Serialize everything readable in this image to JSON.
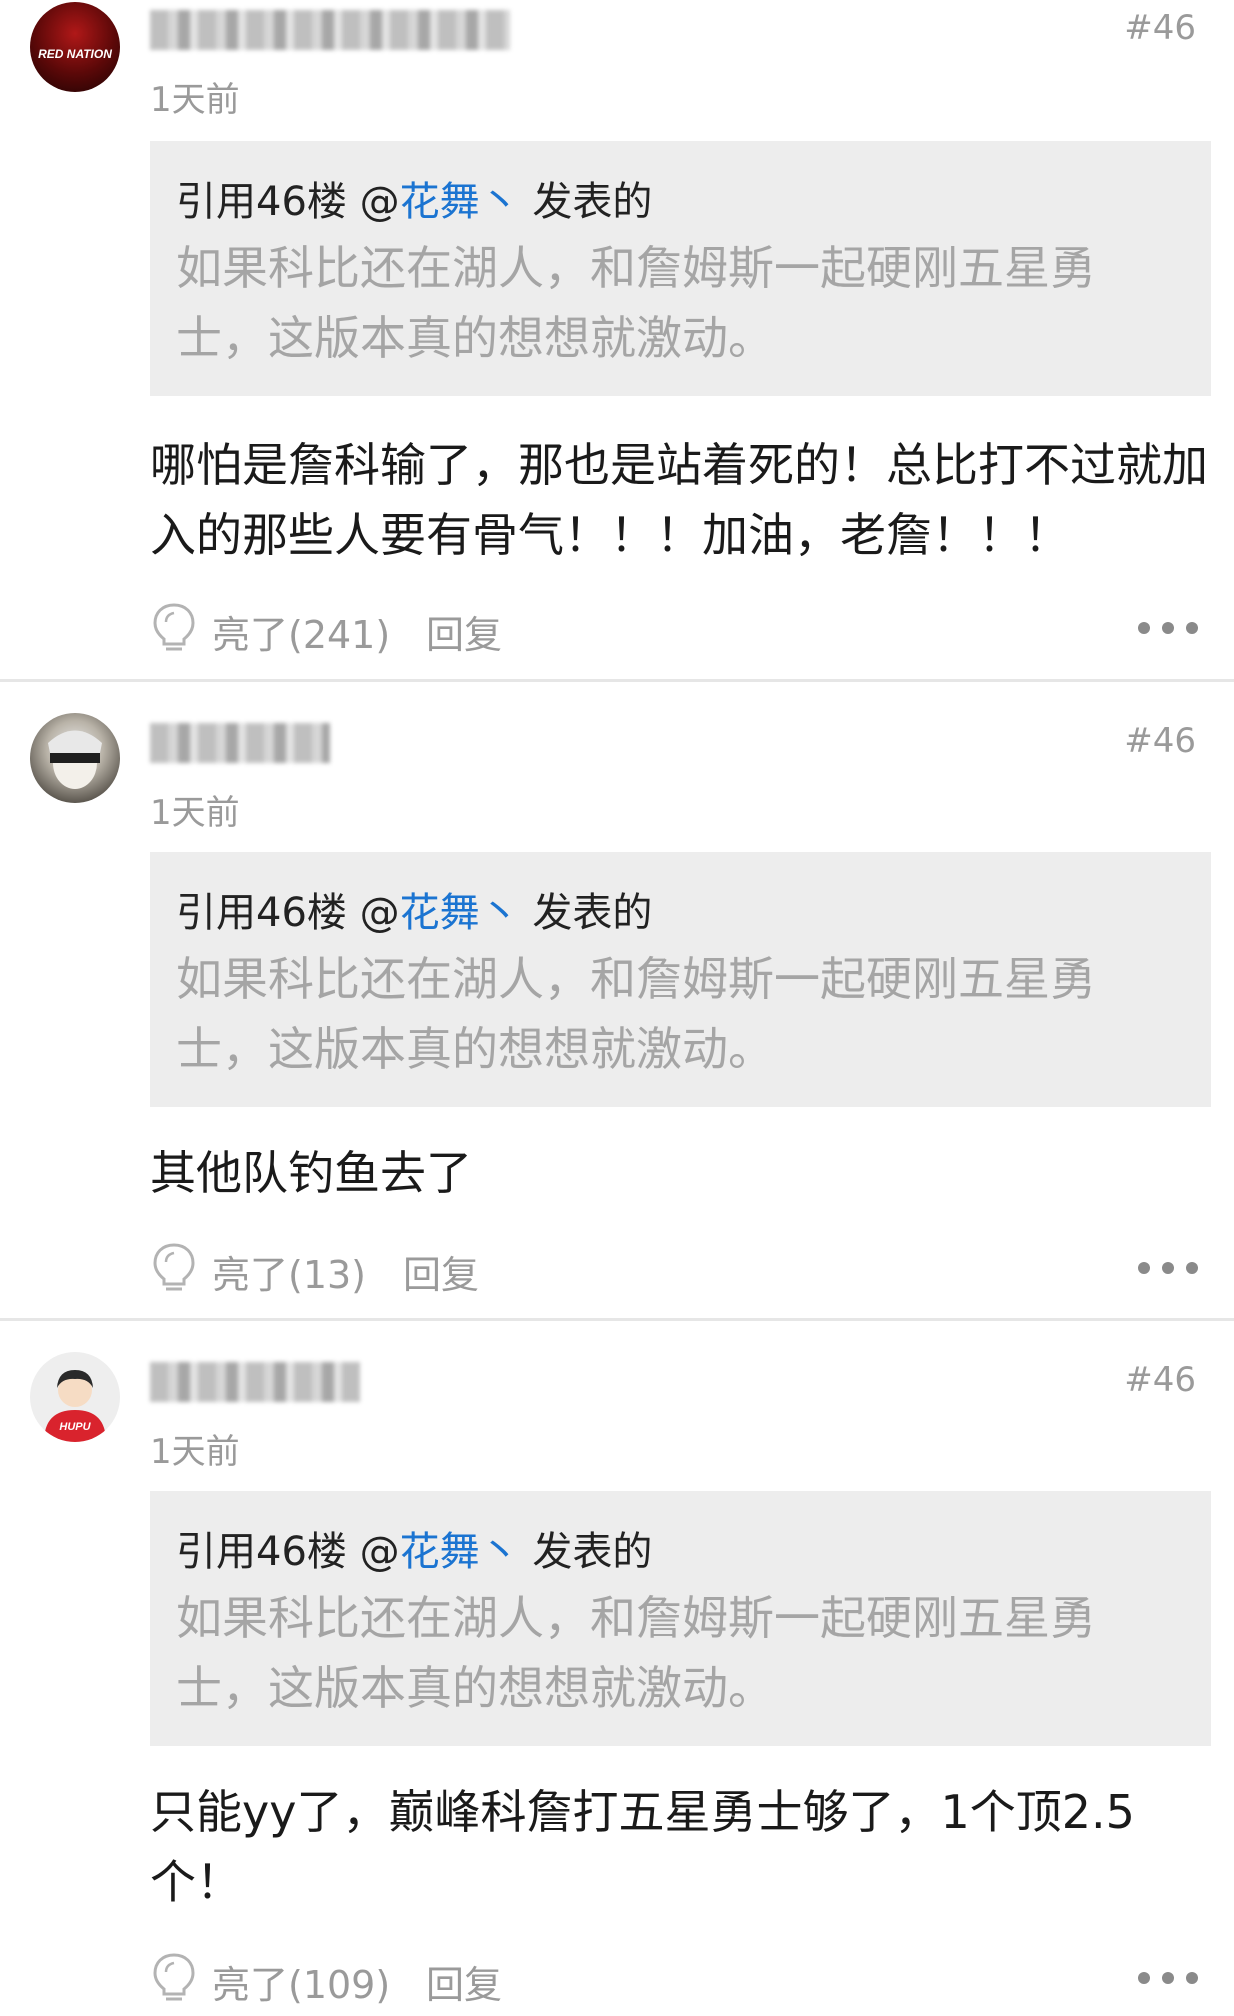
{
  "comments": [
    {
      "floor": "#46",
      "time": "1天前",
      "quote_prefix": "引用46楼 @",
      "quote_author": "花舞丶",
      "quote_suffix": " 发表的",
      "quote_text": "如果科比还在湖人，和詹姆斯一起硬刚五星勇士，这版本真的想想就激动。",
      "body": "哪怕是詹科输了，那也是站着死的！总比打不过就加入的那些人要有骨气！！！加油，老詹！！！",
      "like_label": "亮了(241)",
      "reply_label": "回复",
      "avatar_text": "RED NATION"
    },
    {
      "floor": "#46",
      "time": "1天前",
      "quote_prefix": "引用46楼 @",
      "quote_author": "花舞丶",
      "quote_suffix": " 发表的",
      "quote_text": "如果科比还在湖人，和詹姆斯一起硬刚五星勇士，这版本真的想想就激动。",
      "body": "其他队钓鱼去了",
      "like_label": "亮了(13)",
      "reply_label": "回复"
    },
    {
      "floor": "#46",
      "time": "1天前",
      "quote_prefix": "引用46楼 @",
      "quote_author": "花舞丶",
      "quote_suffix": " 发表的",
      "quote_text": "如果科比还在湖人，和詹姆斯一起硬刚五星勇士，这版本真的想想就激动。",
      "body": "只能yy了，巅峰科詹打五星勇士够了，1个顶2.5个！",
      "like_label": "亮了(109)",
      "reply_label": "回复",
      "avatar_text": "HUPU"
    }
  ],
  "colors": {
    "link": "#1b74d1",
    "muted": "#9a9a9a",
    "quote_bg": "#ededed",
    "hupu_red": "#d9232d"
  },
  "icons": {
    "like": "lightbulb-icon",
    "more": "more-dots-icon"
  }
}
